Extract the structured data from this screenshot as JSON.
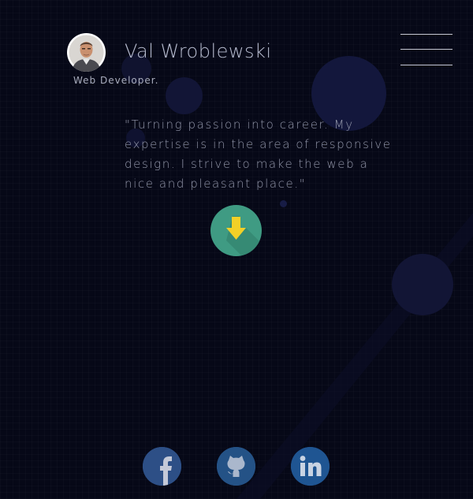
{
  "header": {
    "name": "Val Wroblewski",
    "role": "Web Developer."
  },
  "intro": {
    "quote": "\"Turning passion into career. My expertise is in the area of responsive design. I strive to make the web a nice and pleasant place.\""
  },
  "colors": {
    "background": "#060817",
    "scroll_button": "#3f9b83",
    "arrow": "#f2d028",
    "social_circle": "#2a4f87"
  },
  "icons": {
    "menu": "hamburger-menu-icon",
    "scroll": "arrow-down-icon",
    "social": [
      "facebook-icon",
      "github-icon",
      "linkedin-icon"
    ]
  }
}
